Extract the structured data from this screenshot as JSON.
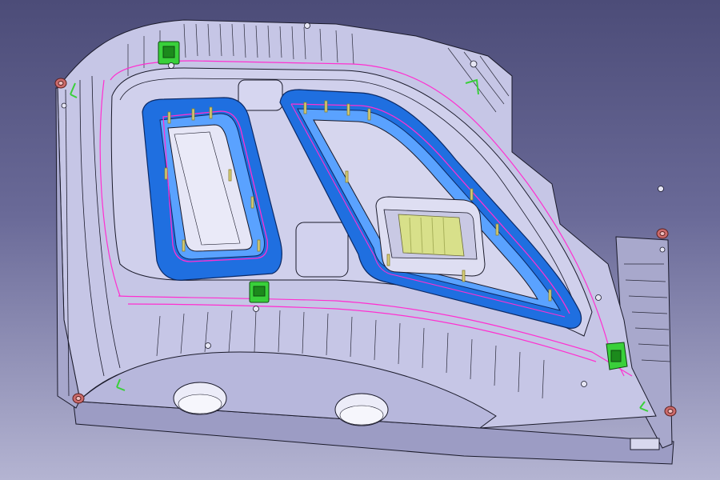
{
  "viewer": {
    "mode": "3d-cad-viewport",
    "background_top_color": "#4c4c78",
    "background_bottom_color": "#b4b4d2"
  },
  "model": {
    "body_color": "#c6c6e6",
    "body_dark_color": "#9c9cc4",
    "edge_color": "#1a1a2a",
    "seal_channel_color": "#1f6fe0",
    "seal_highlight_color": "#5aa2ff",
    "trim_line_color": "#ff2fd0",
    "clip_color": "#39d03a",
    "fastener_color": "#cc6b6b",
    "insert_color": "#d8e08a",
    "guide_pin_color": "#d8cf7a"
  }
}
